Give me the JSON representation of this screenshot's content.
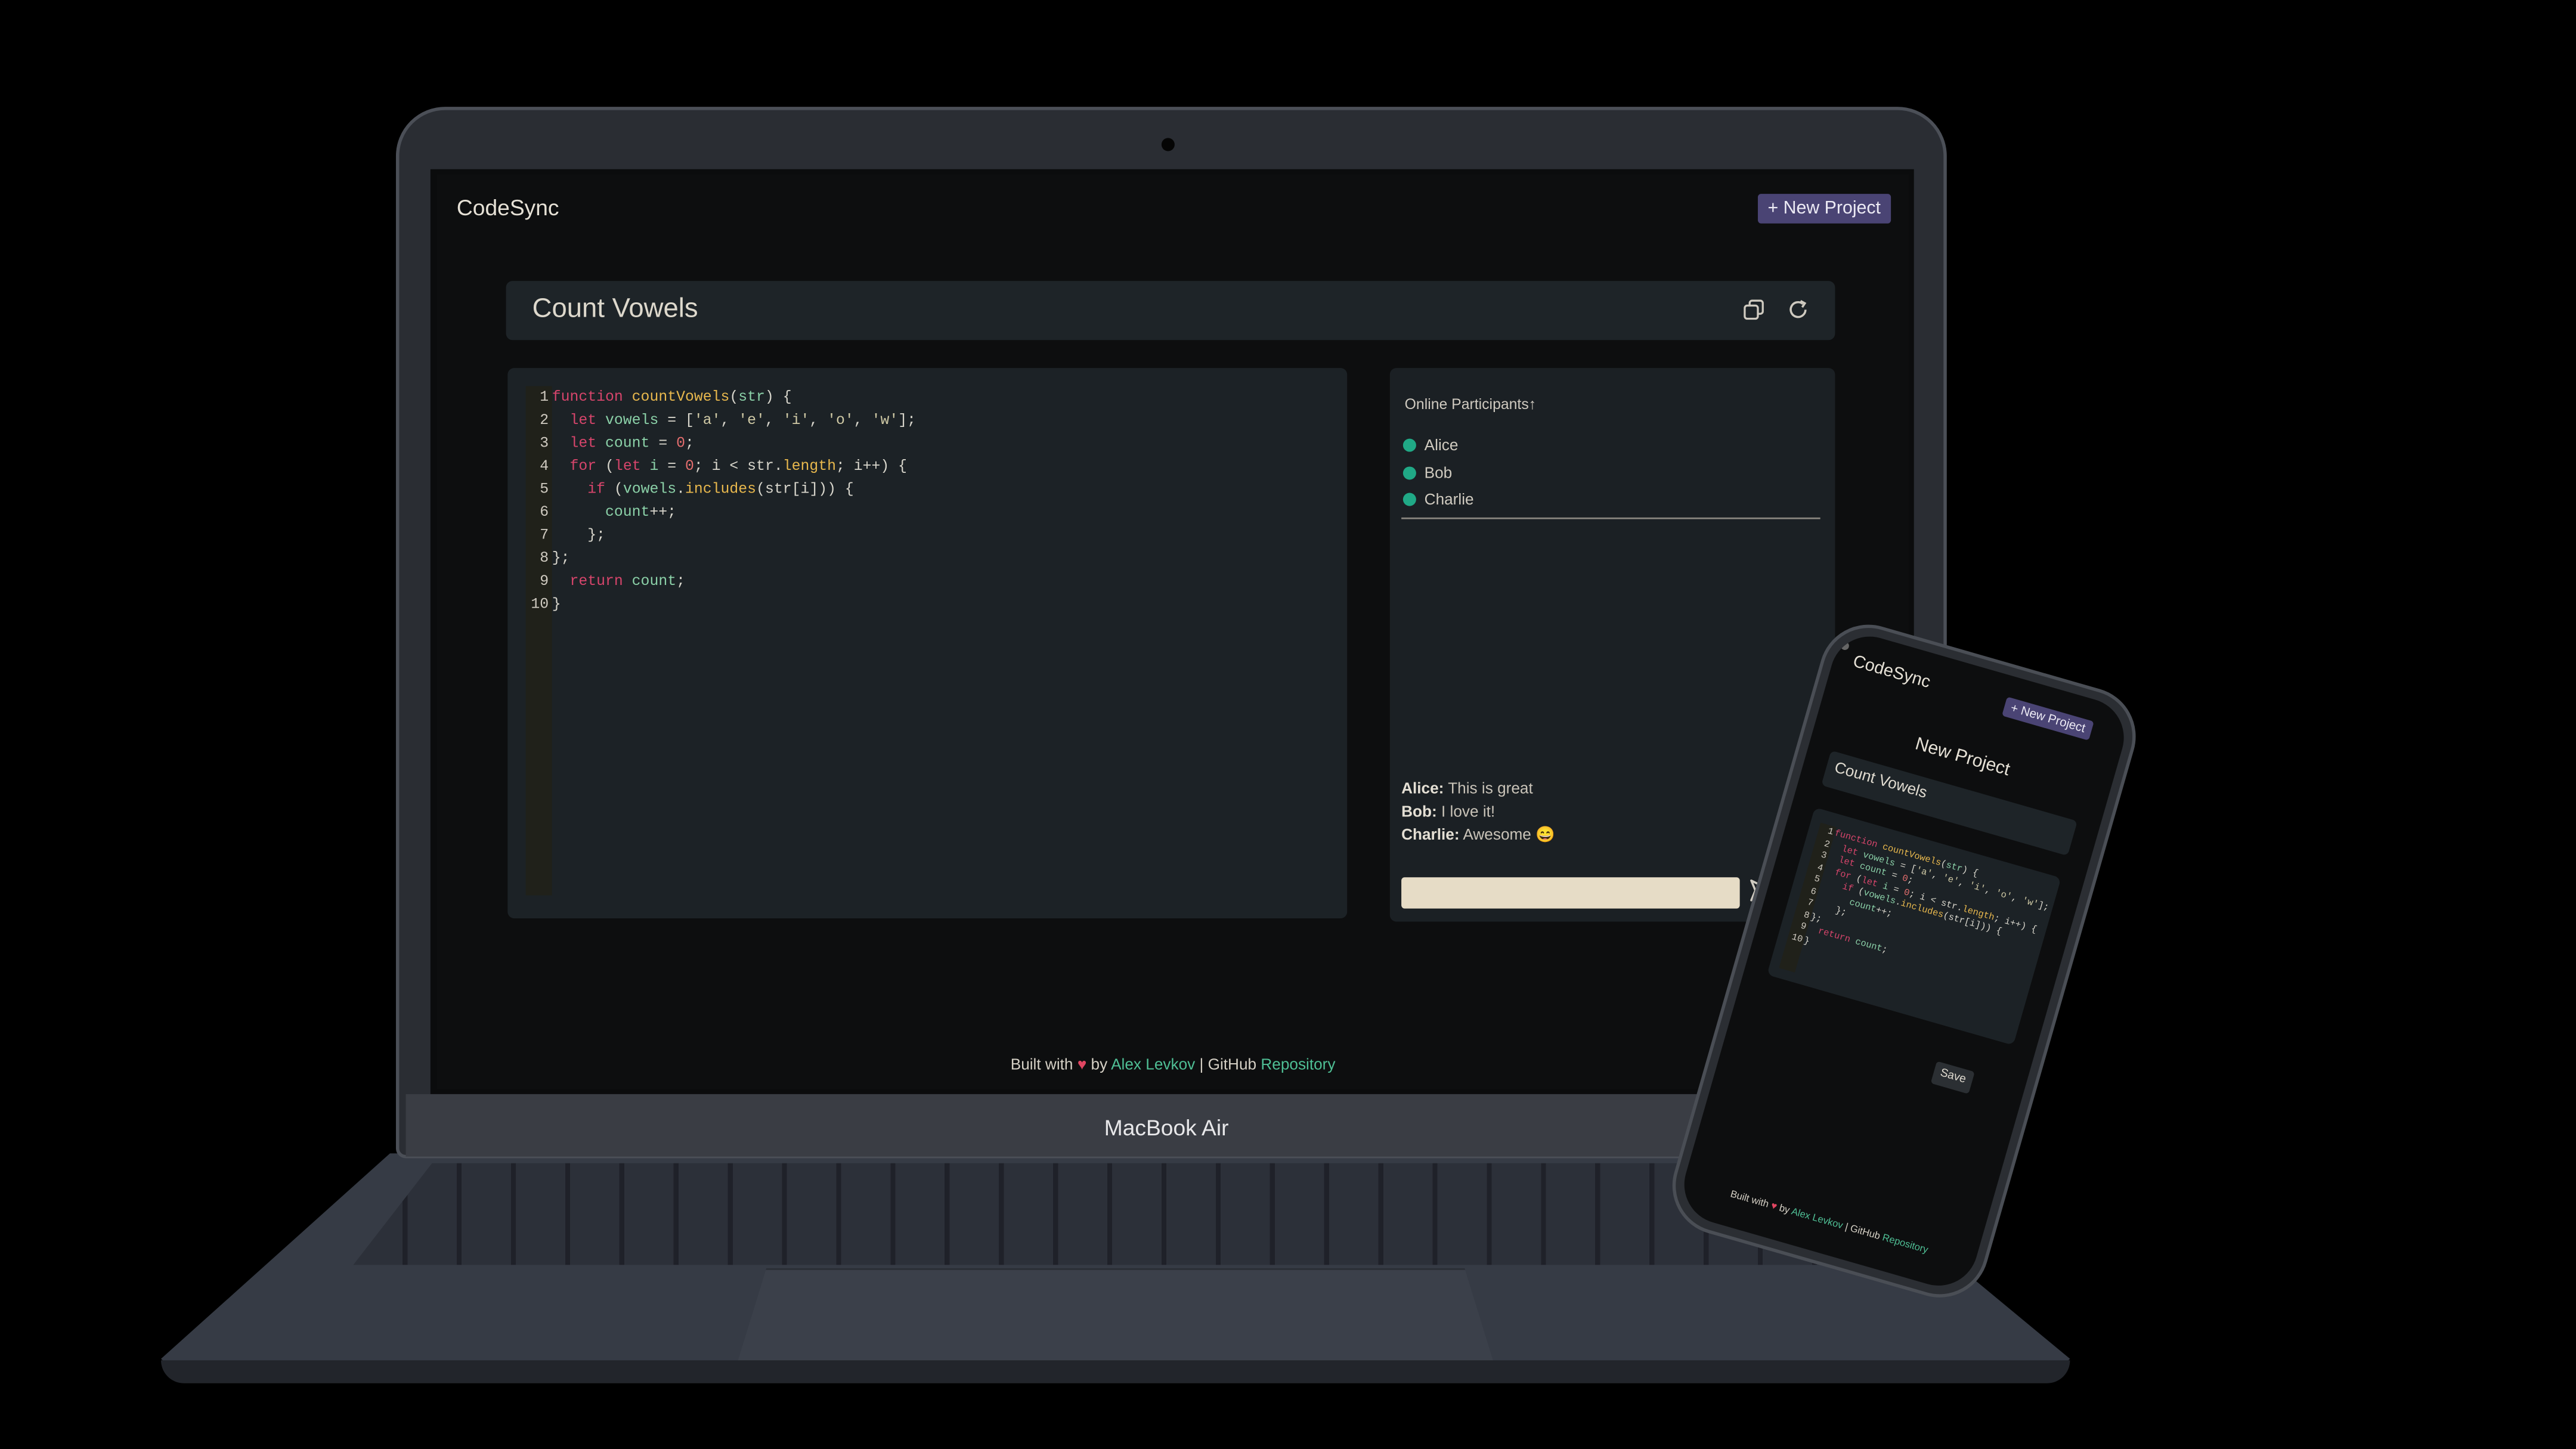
{
  "laptop": {
    "model_label": "MacBook Air"
  },
  "app": {
    "logo": "CodeSync",
    "new_project_label": "+ New Project",
    "project_title": "Count Vowels",
    "icons": {
      "copy": "copy-icon",
      "refresh": "refresh-icon",
      "send": "send-icon",
      "sort": "arrow-up-icon"
    },
    "code_lines": [
      {
        "n": "1",
        "html": "<span class='kw'>function</span> <span class='fn'>countVowels</span>(<span class='vr'>str</span>) {"
      },
      {
        "n": "2",
        "html": "  <span class='kw'>let</span> <span class='vr'>vowels</span> = [<span class='st'>'a'</span>, <span class='st'>'e'</span>, <span class='st'>'i'</span>, <span class='st'>'o'</span>, <span class='st'>'w'</span>];"
      },
      {
        "n": "3",
        "html": "  <span class='kw'>let</span> <span class='vr'>count</span> = <span class='nm'>0</span>;"
      },
      {
        "n": "4",
        "html": "  <span class='kw'>for</span> (<span class='kw'>let</span> <span class='vr'>i</span> = <span class='nm'>0</span>; i &lt; str.<span class='fn'>length</span>; i++) {"
      },
      {
        "n": "5",
        "html": "    <span class='kw'>if</span> (<span class='vr'>vowels</span>.<span class='fn'>includes</span>(str[i])) {"
      },
      {
        "n": "6",
        "html": "      <span class='vr'>count</span>++;"
      },
      {
        "n": "7",
        "html": "    };"
      },
      {
        "n": "8",
        "html": "};"
      },
      {
        "n": "9",
        "html": "  <span class='kw'>return</span> <span class='vr'>count</span>;"
      },
      {
        "n": "10",
        "html": "}"
      }
    ],
    "participants": {
      "heading": "Online Participants",
      "users": [
        "Alice",
        "Bob",
        "Charlie"
      ]
    },
    "chat": {
      "messages": [
        {
          "user": "Alice:",
          "text": "This is great"
        },
        {
          "user": "Bob:",
          "text": "I love it!"
        },
        {
          "user": "Charlie:",
          "text": "Awesome 😄"
        }
      ],
      "input_value": ""
    },
    "footer": {
      "built_with": "Built with",
      "heart": "♥",
      "by": "by",
      "author": "Alex Levkov",
      "separator": "| GitHub",
      "repo": "Repository"
    }
  },
  "phone_app": {
    "logo": "CodeSync",
    "new_project_label": "+ New Project",
    "heading": "New Project",
    "project_name_value": "Count Vowels",
    "save_label": "Save"
  }
}
